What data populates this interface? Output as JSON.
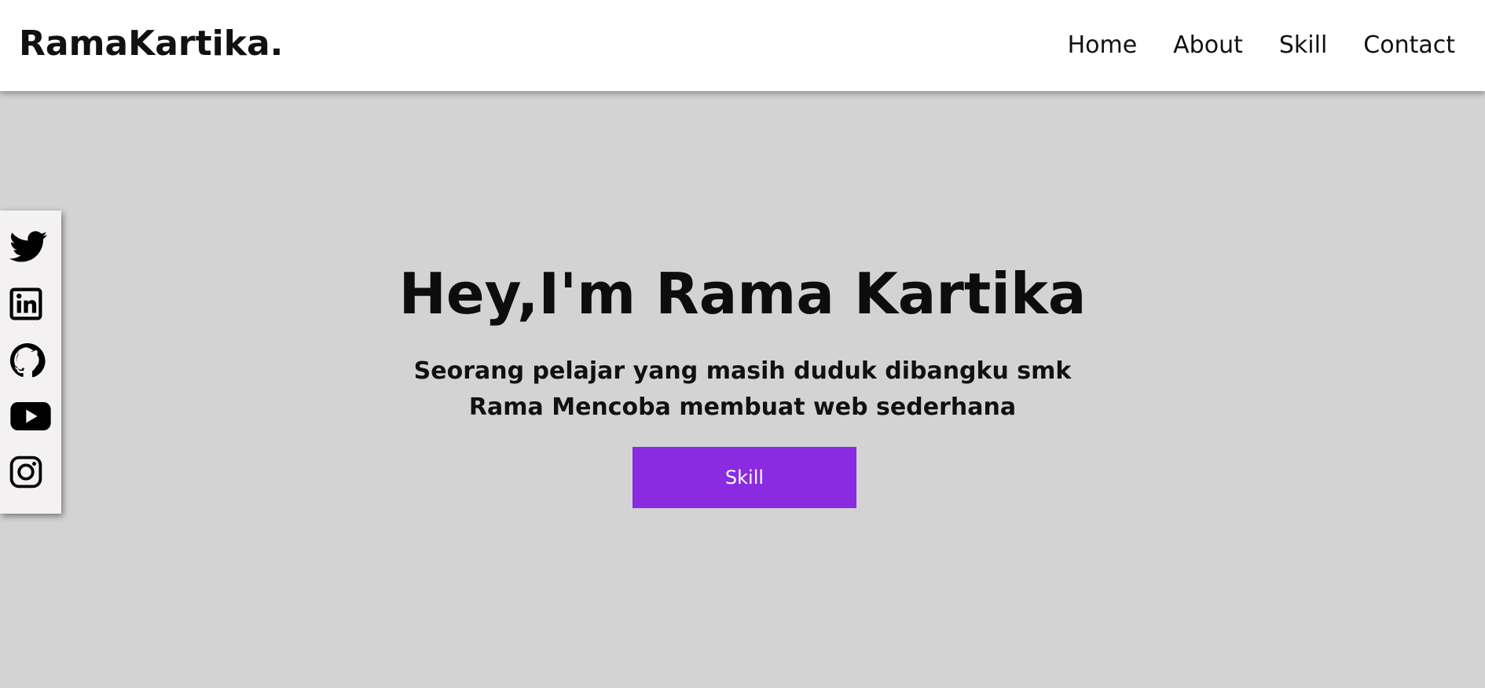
{
  "navbar": {
    "logo": "RamaKartika.",
    "links": [
      "Home",
      "About",
      "Skill",
      "Contact"
    ]
  },
  "social": {
    "icons": [
      "twitter-icon",
      "linkedin-icon",
      "github-icon",
      "youtube-icon",
      "instagram-icon"
    ]
  },
  "hero": {
    "title": "Hey,I'm Rama Kartika",
    "subtitle_line1": "Seorang pelajar yang masih duduk dibangku smk",
    "subtitle_line2": "Rama Mencoba membuat web sederhana",
    "button_label": "Skill"
  },
  "colors": {
    "background": "#d3d3d3",
    "navbar": "#ffffff",
    "button": "#8a2be2",
    "social_bar": "#f3f1f1",
    "text": "#111111"
  }
}
